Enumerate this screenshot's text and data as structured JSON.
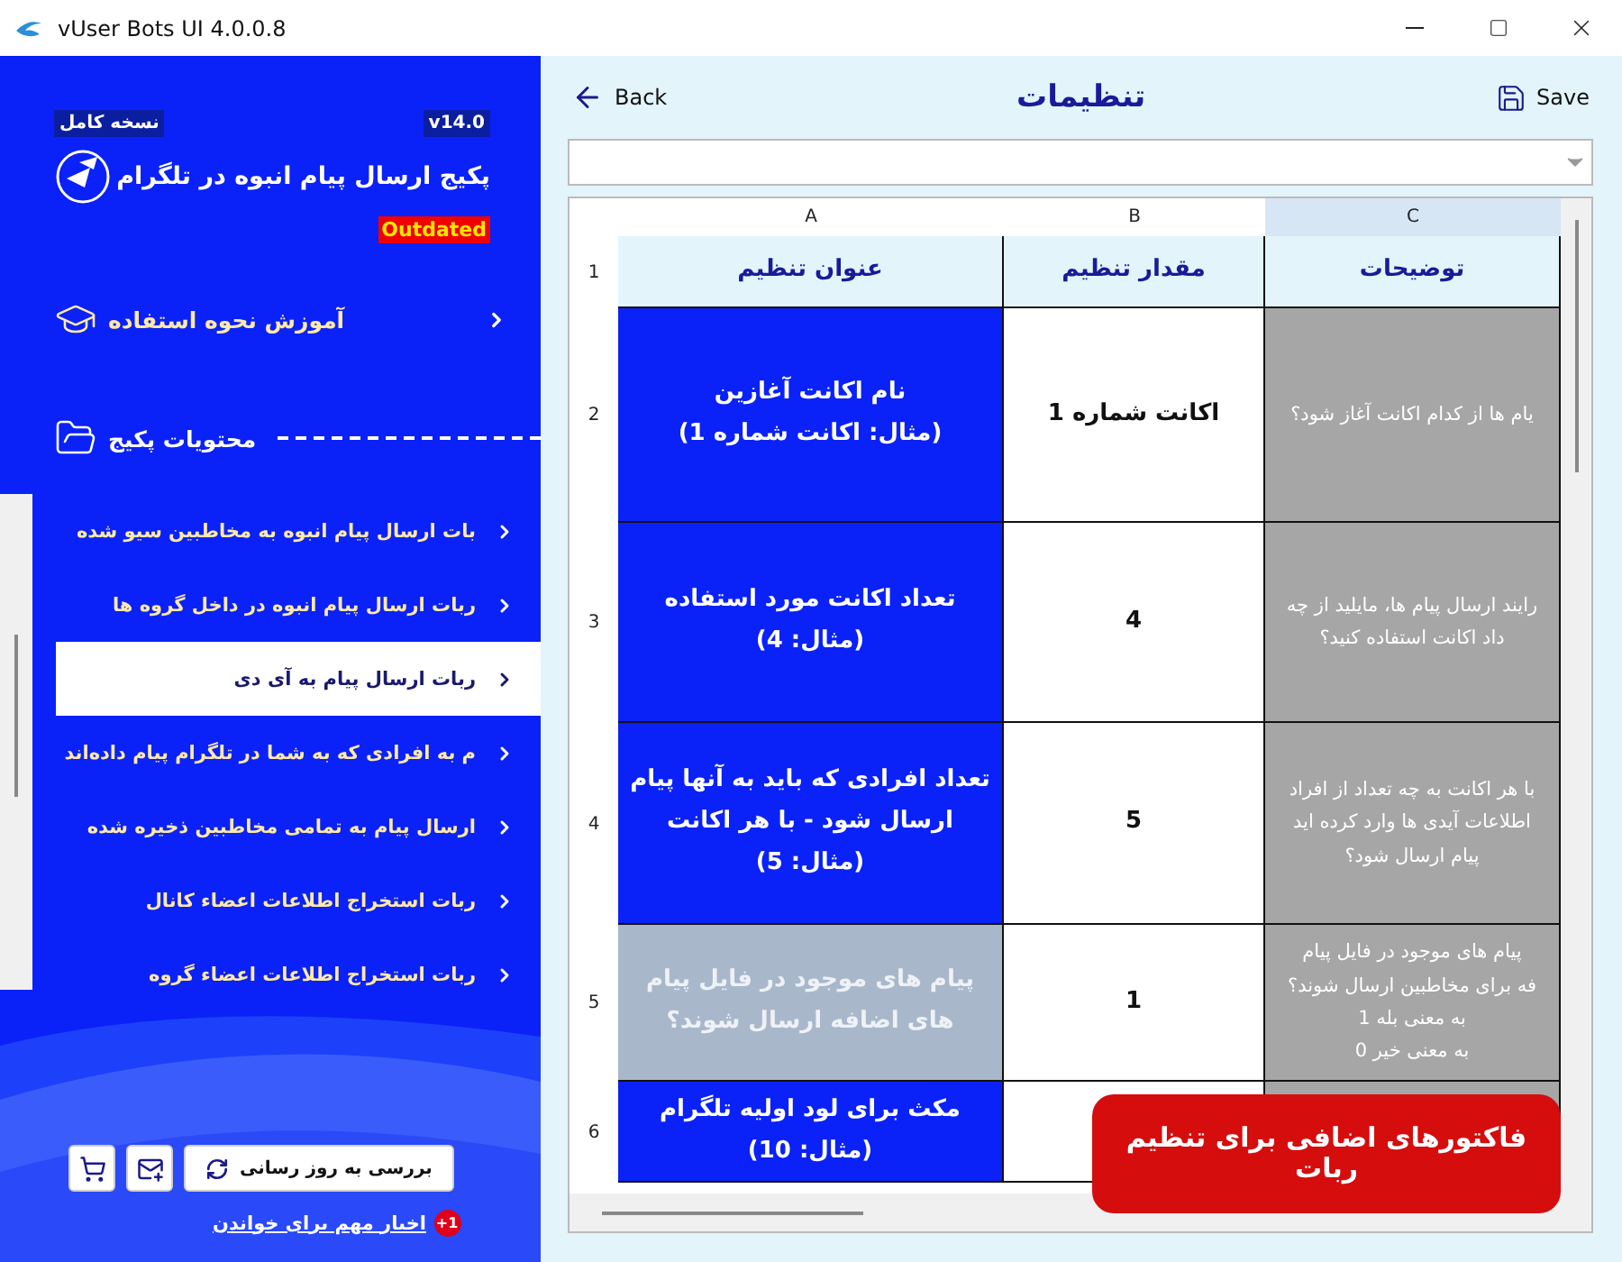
{
  "window": {
    "title": "vUser Bots UI 4.0.0.8"
  },
  "sidebar": {
    "edition": "نسخه کامل",
    "version": "v14.0",
    "title": "پکیج ارسال پیام انبوه در تلگرام",
    "status_badge": "Outdated",
    "tutorial": "آموزش نحوه استفاده",
    "contents_heading": "محتویات پکیج",
    "items": [
      {
        "label": "بات ارسال پیام انبوه به مخاطبین سیو شده",
        "selected": false
      },
      {
        "label": "ربات ارسال پیام انبوه در داخل گروه ها",
        "selected": false
      },
      {
        "label": "ربات ارسال پیام به آی دی",
        "selected": true
      },
      {
        "label": "م به افرادی که به شما در تلگرام پیام داده‌اند",
        "selected": false
      },
      {
        "label": "ارسال پیام به تمامی مخاطبین ذخیره شده",
        "selected": false
      },
      {
        "label": "ربات استخراج اطلاعات اعضاء کانال",
        "selected": false
      },
      {
        "label": "ربات استخراج اطلاعات اعضاء گروه",
        "selected": false
      }
    ],
    "update_button": "بررسی به روز رسانی",
    "news_link": "اخبار مهم برای خواندن",
    "news_badge": "+1"
  },
  "header": {
    "back": "Back",
    "title": "تنظیمات",
    "save": "Save"
  },
  "table": {
    "column_letters": [
      "C",
      "B",
      "A"
    ],
    "rows": [
      {
        "number": "1",
        "kind": "header",
        "disabled": false,
        "description": "توضیحات",
        "value": "مقدار تنظیم",
        "title": "عنوان تنظیم"
      },
      {
        "number": "2",
        "kind": "setting",
        "disabled": false,
        "description": "یام ها از کدام اکانت آغاز شود؟",
        "value": "اکانت شماره 1",
        "title": "نام اکانت آغازین\n(مثال: اکانت شماره 1)"
      },
      {
        "number": "3",
        "kind": "setting",
        "disabled": false,
        "description": "رایند ارسال پیام ها، مایلید از چه\nداد اکانت استفاده کنید؟",
        "value": "4",
        "title": "تعداد اکانت مورد استفاده\n(مثال: 4)"
      },
      {
        "number": "4",
        "kind": "setting",
        "disabled": false,
        "description": "با هر اکانت به چه تعداد از افراد\nاطلاعات آیدی ها وارد کرده اید\nپیام ارسال شود؟",
        "value": "5",
        "title": "تعداد افرادی که باید به آنها پیام ارسال شود - با هر اکانت\n(مثال: 5)"
      },
      {
        "number": "5",
        "kind": "setting",
        "disabled": true,
        "description": "پیام های موجود در فایل پیام\nفه برای مخاطبین ارسال شوند؟\nبه معنی بله 1\nبه معنی خیر 0",
        "value": "1",
        "title": "پیام های موجود در فایل پیام های اضافه ارسال شوند؟"
      },
      {
        "number": "6",
        "kind": "setting",
        "disabled": false,
        "title": "مکث برای لود اولیه تلگرام\n(مثال: 10)"
      }
    ]
  },
  "toast": "فاکتورهای اضافی برای تنظیم ربات"
}
